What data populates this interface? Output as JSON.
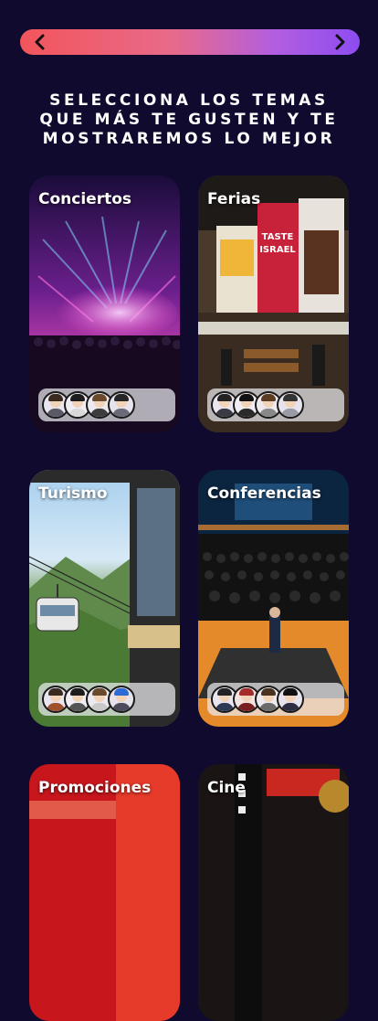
{
  "nav": {
    "prev_icon": "chevron-left-icon",
    "next_icon": "chevron-right-icon",
    "gradient": [
      "#f2555b",
      "#8d4cf0"
    ]
  },
  "headline": {
    "lines": [
      "SELECCIONA LOS TEMAS",
      "QUE MÁS TE GUSTEN Y TE",
      "MOSTRAREMOS LO MEJOR"
    ]
  },
  "topics": [
    {
      "label": "Conciertos",
      "avatars": 4
    },
    {
      "label": "Ferias",
      "avatars": 4,
      "image_text": [
        "TASTE",
        "ISRAEL"
      ]
    },
    {
      "label": "Turismo",
      "avatars": 4
    },
    {
      "label": "Conferencias",
      "avatars": 4
    },
    {
      "label": "Promociones"
    },
    {
      "label": "Cine"
    }
  ],
  "colors": {
    "background": "#0f0a2e",
    "text": "#ffffff"
  }
}
